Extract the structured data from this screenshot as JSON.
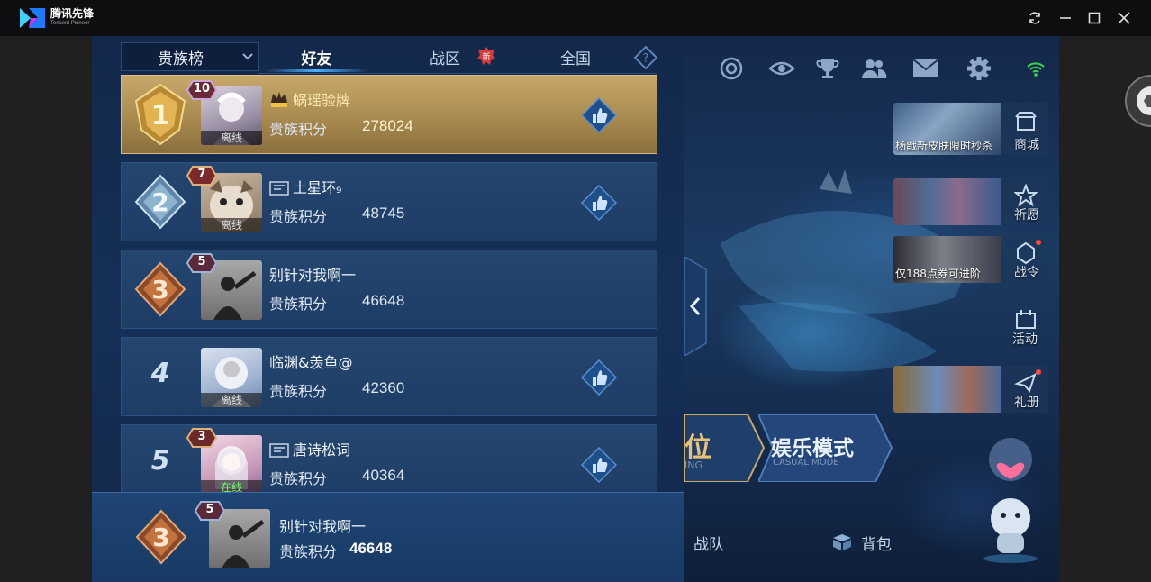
{
  "window": {
    "app_name": "腾讯先锋",
    "app_sub": "Tencent Pioneer"
  },
  "tabs": {
    "dropdown": "贵族榜",
    "items": [
      {
        "label": "好友",
        "active": true
      },
      {
        "label": "战区",
        "active": false
      },
      {
        "label": "全国",
        "active": false
      }
    ],
    "new_badge": "新"
  },
  "leaderboard": [
    {
      "rank": "1",
      "level": "10",
      "name": "蜗瑶验牌",
      "vip": "SVIP",
      "score_label": "贵族积分",
      "score": "278024",
      "status": "离线"
    },
    {
      "rank": "2",
      "level": "7",
      "name": "土星环₉",
      "score_label": "贵族积分",
      "score": "48745",
      "status": "离线"
    },
    {
      "rank": "3",
      "level": "5",
      "name": "别针对我啊一",
      "score_label": "贵族积分",
      "score": "46648",
      "status": ""
    },
    {
      "rank": "4",
      "level": "",
      "name": "临渊&羡鱼@",
      "score_label": "贵族积分",
      "score": "42360",
      "status": "离线"
    },
    {
      "rank": "5",
      "level": "3",
      "name": "唐诗松词",
      "score_label": "贵族积分",
      "score": "40364",
      "status": "在线"
    }
  ],
  "self": {
    "rank": "3",
    "level": "5",
    "name": "别针对我啊一",
    "score_label": "贵族积分",
    "score": "46648"
  },
  "side_menu": [
    {
      "label": "商城",
      "caption": "杨戬新皮肤限时秒杀"
    },
    {
      "label": "祈愿",
      "caption": ""
    },
    {
      "label": "战令",
      "caption": "仅188点券可进阶"
    },
    {
      "label": "活动",
      "caption": ""
    },
    {
      "label": "礼册",
      "caption": ""
    }
  ],
  "modes": {
    "ranked_partial": "位",
    "ranked_sub": "ING",
    "casual": "娱乐模式",
    "casual_sub": "CASUAL MODE"
  },
  "bottom_nav": {
    "team": "战队",
    "bag": "背包"
  },
  "colors": {
    "accent": "#4fb0ff",
    "gold_row": "#c8a86a",
    "online": "#6bff6b"
  }
}
